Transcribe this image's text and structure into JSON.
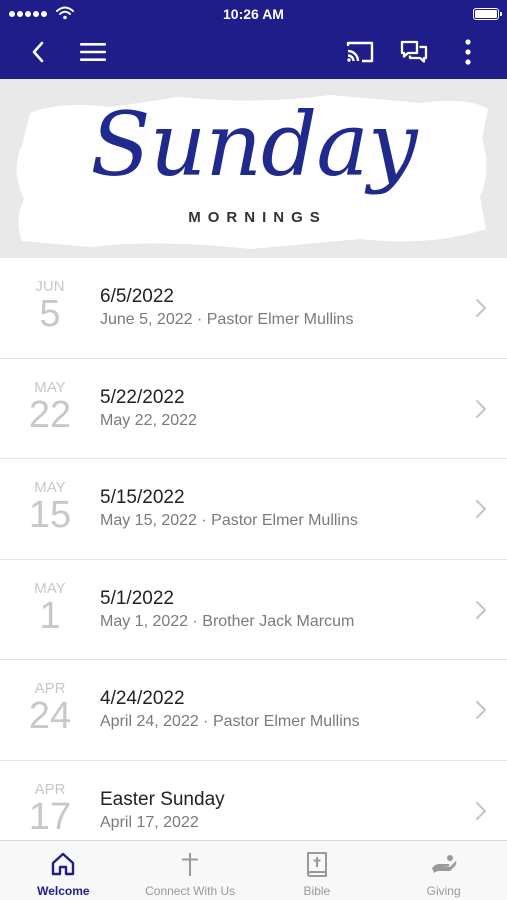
{
  "status_bar": {
    "time": "10:26 AM"
  },
  "nav": {
    "back_icon": "chevron-left-icon",
    "menu_icon": "hamburger-menu-icon",
    "cast_icon": "cast-icon",
    "chat_icon": "chat-bubbles-icon",
    "more_icon": "more-vertical-icon"
  },
  "banner": {
    "script_text": "Sunday",
    "subtitle": "MORNINGS"
  },
  "colors": {
    "nav_bg": "#1f1d8a",
    "accent": "#1f1d8a",
    "script": "#1f2a8c"
  },
  "sermons": [
    {
      "month": "JUN",
      "day": "5",
      "title": "6/5/2022",
      "subtitle": "June 5, 2022 · Pastor Elmer Mullins"
    },
    {
      "month": "MAY",
      "day": "22",
      "title": "5/22/2022",
      "subtitle": "May 22, 2022"
    },
    {
      "month": "MAY",
      "day": "15",
      "title": "5/15/2022",
      "subtitle": "May 15, 2022 · Pastor Elmer Mullins"
    },
    {
      "month": "MAY",
      "day": "1",
      "title": "5/1/2022",
      "subtitle": "May 1, 2022 · Brother Jack Marcum"
    },
    {
      "month": "APR",
      "day": "24",
      "title": "4/24/2022",
      "subtitle": "April 24, 2022 · Pastor Elmer Mullins"
    },
    {
      "month": "APR",
      "day": "17",
      "title": "Easter Sunday",
      "subtitle": "April 17, 2022"
    }
  ],
  "tabs": [
    {
      "label": "Welcome",
      "icon": "home-icon",
      "active": true
    },
    {
      "label": "Connect With Us",
      "icon": "cross-icon",
      "active": false
    },
    {
      "label": "Bible",
      "icon": "bible-icon",
      "active": false
    },
    {
      "label": "Giving",
      "icon": "giving-hand-icon",
      "active": false
    }
  ]
}
